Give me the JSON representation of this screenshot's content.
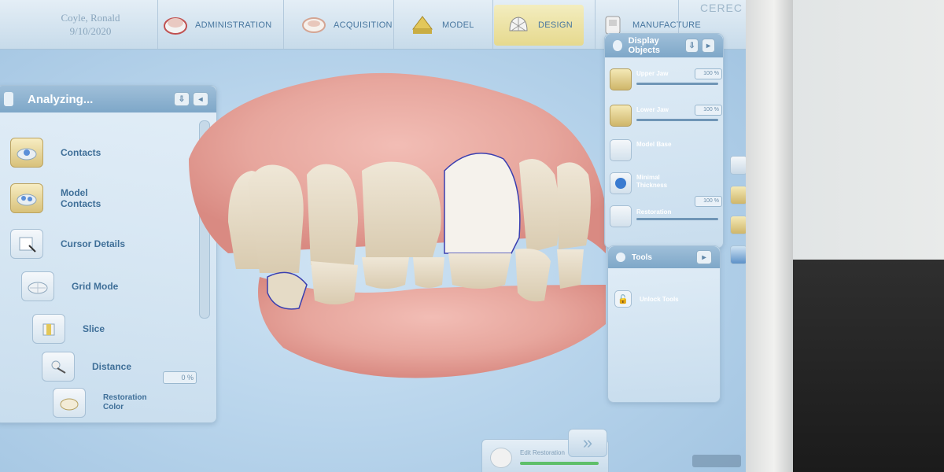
{
  "patient": {
    "name": "Coyle, Ronald",
    "date": "9/10/2020"
  },
  "workflow": {
    "steps": [
      {
        "label": "ADMINISTRATION",
        "icon": "administration-icon"
      },
      {
        "label": "ACQUISITION",
        "icon": "acquisition-icon"
      },
      {
        "label": "MODEL",
        "icon": "model-icon"
      },
      {
        "label": "DESIGN",
        "icon": "design-icon",
        "active": true
      },
      {
        "label": "MANUFACTURE",
        "icon": "manufacture-icon"
      }
    ],
    "brand": "CEREC"
  },
  "left_panel": {
    "title": "Analyzing...",
    "items": [
      {
        "label": "Contacts",
        "icon": "contacts-icon",
        "selected": true
      },
      {
        "label": "Model\nContacts",
        "icon": "model-contacts-icon",
        "selected": true
      },
      {
        "label": "Cursor Details",
        "icon": "cursor-details-icon"
      },
      {
        "label": "Grid Mode",
        "icon": "grid-mode-icon"
      },
      {
        "label": "Slice",
        "icon": "slice-icon"
      },
      {
        "label": "Distance",
        "icon": "distance-icon"
      },
      {
        "label": "Restoration\nColor",
        "icon": "restoration-color-icon"
      }
    ],
    "percent": "0 %"
  },
  "display_objects": {
    "title": "Display Objects",
    "items": [
      {
        "label": "Upper Jaw",
        "value": "100 %",
        "level": 1.0,
        "icon": "upper-jaw-icon"
      },
      {
        "label": "Lower Jaw",
        "value": "100 %",
        "level": 1.0,
        "icon": "lower-jaw-icon"
      },
      {
        "label": "Model Base",
        "icon": "model-base-icon"
      },
      {
        "label": "Minimal\nThickness",
        "icon": "minimal-thickness-icon"
      },
      {
        "label": "Restoration",
        "value": "100 %",
        "level": 1.0,
        "icon": "restoration-icon"
      }
    ]
  },
  "tools": {
    "title": "Tools",
    "items": [
      {
        "label": "Unlock Tools",
        "icon": "unlock-icon"
      }
    ]
  },
  "bottom": {
    "edit_label": "Edit Restoration",
    "next_icon": "double-chevron-right-icon"
  },
  "colors": {
    "accent": "#7ea7c8",
    "active_step": "#e6d98e",
    "background": "#b9d5ec"
  }
}
